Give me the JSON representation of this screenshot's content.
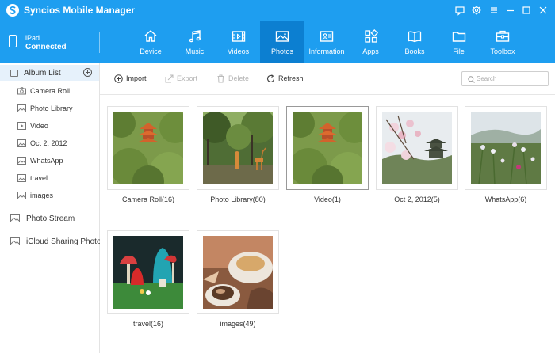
{
  "app": {
    "title": "Syncios Mobile Manager",
    "brand_color": "#1e9ef0",
    "active_tab_color": "#0c7fd1"
  },
  "window_controls": [
    {
      "name": "feedback-icon"
    },
    {
      "name": "settings-icon"
    },
    {
      "name": "menu-icon"
    },
    {
      "name": "minimize-icon"
    },
    {
      "name": "maximize-icon"
    },
    {
      "name": "close-icon"
    }
  ],
  "device": {
    "name": "iPad",
    "status": "Connected",
    "icon": "tablet-icon"
  },
  "nav": {
    "active": "Photos",
    "tabs": [
      {
        "label": "Device",
        "icon": "home-icon"
      },
      {
        "label": "Music",
        "icon": "music-note-icon"
      },
      {
        "label": "Videos",
        "icon": "film-icon"
      },
      {
        "label": "Photos",
        "icon": "photo-icon"
      },
      {
        "label": "Information",
        "icon": "contact-card-icon"
      },
      {
        "label": "Apps",
        "icon": "apps-grid-icon"
      },
      {
        "label": "Books",
        "icon": "open-book-icon"
      },
      {
        "label": "File",
        "icon": "folder-icon"
      },
      {
        "label": "Toolbox",
        "icon": "toolbox-icon"
      }
    ]
  },
  "sidebar": {
    "album_list_label": "Album List",
    "albums": [
      {
        "label": "Camera Roll",
        "icon": "camera-icon"
      },
      {
        "label": "Photo Library",
        "icon": "image-icon"
      },
      {
        "label": "Video",
        "icon": "play-icon"
      },
      {
        "label": "Oct 2, 2012",
        "icon": "image-icon"
      },
      {
        "label": "WhatsApp",
        "icon": "image-icon"
      },
      {
        "label": "travel",
        "icon": "image-icon"
      },
      {
        "label": "images",
        "icon": "image-icon"
      }
    ],
    "photo_stream_label": "Photo Stream",
    "icloud_label": "iCloud Sharing Photo"
  },
  "toolbar": {
    "import_label": "Import",
    "export_label": "Export",
    "delete_label": "Delete",
    "refresh_label": "Refresh",
    "search_placeholder": "Search"
  },
  "albums": [
    {
      "caption": "Camera Roll(16)",
      "picture": "pagoda-in-trees"
    },
    {
      "caption": "Photo Library(80)",
      "picture": "deer-statues-in-park"
    },
    {
      "caption": "Video(1)",
      "picture": "pagoda-in-trees",
      "selected": true
    },
    {
      "caption": "Oct 2, 2012(5)",
      "picture": "blossoms-and-pagoda"
    },
    {
      "caption": "WhatsApp(6)",
      "picture": "wildflowers-and-hills"
    },
    {
      "caption": "travel(16)",
      "picture": "mushroom-figurines"
    },
    {
      "caption": "images(49)",
      "picture": "coffee-and-pastries"
    }
  ]
}
